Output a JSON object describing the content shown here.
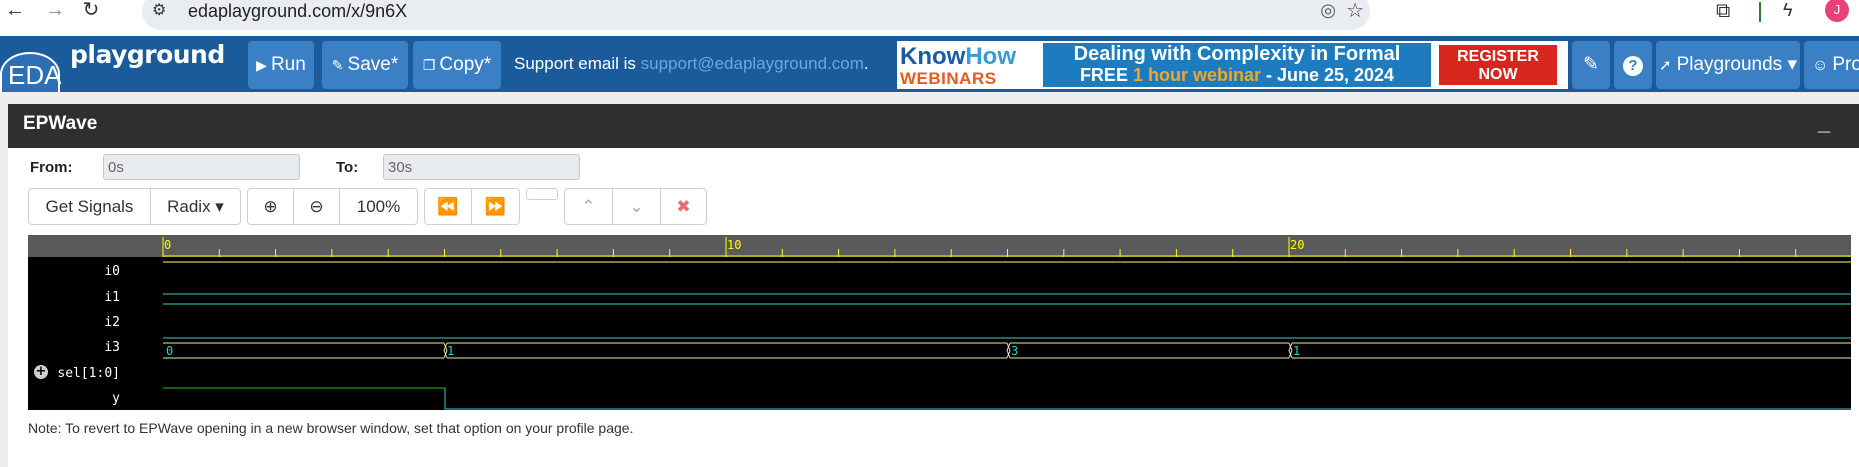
{
  "browser": {
    "url": "edaplayground.com/x/9n6X",
    "back_icon": "←",
    "forward_icon": "→",
    "reload_icon": "↻",
    "site_icon": "⚙",
    "eye_off_icon": "◎",
    "star_icon": "☆",
    "extensions_icon": "⧉",
    "bolt_icon": "ϟ",
    "profile_initial": "J"
  },
  "navbar": {
    "logo_eda": "EDA",
    "logo_playground": "playground",
    "run_label": "Run",
    "save_label": "Save*",
    "copy_label": "Copy*",
    "support_text": "Support email is ",
    "support_email": "support@edaplayground.com",
    "support_end": ".",
    "playgrounds_label": "Playgrounds ▾",
    "profile_label": "Pro",
    "edit_icon": "✎",
    "help_icon": "?"
  },
  "banner": {
    "knowhow_a": "Know",
    "knowhow_b": "How",
    "webinars": "WEBINARS",
    "line1": "Dealing with Complexity in Formal",
    "line2_a": "FREE ",
    "line2_b": "1 hour webinar",
    "line2_c": " - June 25, 2024",
    "register_1": "REGISTER",
    "register_2": "NOW"
  },
  "epwave": {
    "title": "EPWave",
    "minimize_icon": "_",
    "from_label": "From:",
    "from_value": "0s",
    "to_label": "To:",
    "to_value": "30s",
    "get_signals": "Get Signals",
    "radix": "Radix ▾",
    "zoom_in_icon": "⊕",
    "zoom_out_icon": "⊖",
    "zoom_level": "100%",
    "rewind_icon": "⏪",
    "fastforward_icon": "⏩",
    "up_icon": "⌃",
    "down_icon": "⌄",
    "close_icon": "✖",
    "note": "Note: To revert to EPWave opening in a new browser window, set that option on your profile page."
  },
  "waveform": {
    "time_labels": [
      "0",
      "10",
      "20"
    ],
    "signals": [
      "i0",
      "i1",
      "i2",
      "i3",
      "sel[1:0]",
      "y"
    ],
    "sel_values": [
      "0",
      "1",
      "3",
      "1"
    ],
    "colors": {
      "trace": "#2fd0c8",
      "bus_value": "#2fd0c8",
      "ruler": "#5a5a5a",
      "ruler_tick": "#ffff00",
      "low": "#25c025"
    }
  }
}
